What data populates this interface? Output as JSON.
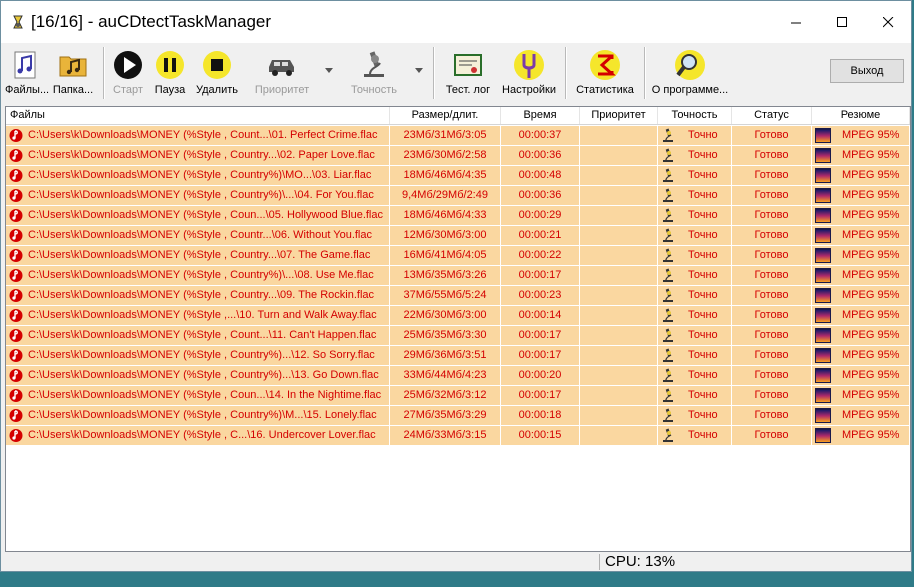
{
  "window": {
    "title": "[16/16] - auCDtectTaskManager"
  },
  "toolbar": {
    "files": "Файлы...",
    "folder": "Папка...",
    "start": "Старт",
    "pause": "Пауза",
    "delete": "Удалить",
    "priority": "Приоритет",
    "accuracy": "Точность",
    "test_log": "Тест. лог",
    "settings": "Настройки",
    "stats": "Статистика",
    "about": "О программе...",
    "exit": "Выход"
  },
  "columns": [
    "Файлы",
    "Размер/длит.",
    "Время",
    "Приоритет",
    "Точность",
    "Статус",
    "Резюме"
  ],
  "rows": [
    {
      "file": "C:\\Users\\k\\Downloads\\MONEY   (%Style , Count...\\01. Perfect Crime.flac",
      "size": "23Мб/31Мб/3:05",
      "time": "00:00:37",
      "priority": "",
      "accuracy": "Точно",
      "status": "Готово",
      "summary": "MPEG 95%"
    },
    {
      "file": "C:\\Users\\k\\Downloads\\MONEY   (%Style , Country...\\02. Paper Love.flac",
      "size": "23Мб/30Мб/2:58",
      "time": "00:00:36",
      "priority": "",
      "accuracy": "Точно",
      "status": "Готово",
      "summary": "MPEG 95%"
    },
    {
      "file": "C:\\Users\\k\\Downloads\\MONEY   (%Style , Country%)\\MO...\\03. Liar.flac",
      "size": "18Мб/46Мб/4:35",
      "time": "00:00:48",
      "priority": "",
      "accuracy": "Точно",
      "status": "Готово",
      "summary": "MPEG 95%"
    },
    {
      "file": "C:\\Users\\k\\Downloads\\MONEY   (%Style , Country%)\\...\\04. For You.flac",
      "size": "9,4Мб/29Мб/2:49",
      "time": "00:00:36",
      "priority": "",
      "accuracy": "Точно",
      "status": "Готово",
      "summary": "MPEG 95%"
    },
    {
      "file": "C:\\Users\\k\\Downloads\\MONEY   (%Style , Coun...\\05. Hollywood Blue.flac",
      "size": "18Мб/46Мб/4:33",
      "time": "00:00:29",
      "priority": "",
      "accuracy": "Точно",
      "status": "Готово",
      "summary": "MPEG 95%"
    },
    {
      "file": "C:\\Users\\k\\Downloads\\MONEY   (%Style , Countr...\\06. Without You.flac",
      "size": "12Мб/30Мб/3:00",
      "time": "00:00:21",
      "priority": "",
      "accuracy": "Точно",
      "status": "Готово",
      "summary": "MPEG 95%"
    },
    {
      "file": "C:\\Users\\k\\Downloads\\MONEY   (%Style , Country...\\07. The Game.flac",
      "size": "16Мб/41Мб/4:05",
      "time": "00:00:22",
      "priority": "",
      "accuracy": "Точно",
      "status": "Готово",
      "summary": "MPEG 95%"
    },
    {
      "file": "C:\\Users\\k\\Downloads\\MONEY   (%Style , Country%)\\...\\08. Use Me.flac",
      "size": "13Мб/35Мб/3:26",
      "time": "00:00:17",
      "priority": "",
      "accuracy": "Точно",
      "status": "Готово",
      "summary": "MPEG 95%"
    },
    {
      "file": "C:\\Users\\k\\Downloads\\MONEY   (%Style , Country...\\09. The Rockin.flac",
      "size": "37Мб/55Мб/5:24",
      "time": "00:00:23",
      "priority": "",
      "accuracy": "Точно",
      "status": "Готово",
      "summary": "MPEG 95%"
    },
    {
      "file": "C:\\Users\\k\\Downloads\\MONEY   (%Style ,...\\10. Turn and Walk Away.flac",
      "size": "22Мб/30Мб/3:00",
      "time": "00:00:14",
      "priority": "",
      "accuracy": "Точно",
      "status": "Готово",
      "summary": "MPEG 95%"
    },
    {
      "file": "C:\\Users\\k\\Downloads\\MONEY   (%Style , Count...\\11. Can't Happen.flac",
      "size": "25Мб/35Мб/3:30",
      "time": "00:00:17",
      "priority": "",
      "accuracy": "Точно",
      "status": "Готово",
      "summary": "MPEG 95%"
    },
    {
      "file": "C:\\Users\\k\\Downloads\\MONEY   (%Style , Country%)...\\12. So Sorry.flac",
      "size": "29Мб/36Мб/3:51",
      "time": "00:00:17",
      "priority": "",
      "accuracy": "Точно",
      "status": "Готово",
      "summary": "MPEG 95%"
    },
    {
      "file": "C:\\Users\\k\\Downloads\\MONEY   (%Style , Country%)...\\13. Go Down.flac",
      "size": "33Мб/44Мб/4:23",
      "time": "00:00:20",
      "priority": "",
      "accuracy": "Точно",
      "status": "Готово",
      "summary": "MPEG 95%"
    },
    {
      "file": "C:\\Users\\k\\Downloads\\MONEY   (%Style , Coun...\\14. In the Nightime.flac",
      "size": "25Мб/32Мб/3:12",
      "time": "00:00:17",
      "priority": "",
      "accuracy": "Точно",
      "status": "Готово",
      "summary": "MPEG 95%"
    },
    {
      "file": "C:\\Users\\k\\Downloads\\MONEY   (%Style , Country%)\\M...\\15. Lonely.flac",
      "size": "27Мб/35Мб/3:29",
      "time": "00:00:18",
      "priority": "",
      "accuracy": "Точно",
      "status": "Готово",
      "summary": "MPEG 95%"
    },
    {
      "file": "C:\\Users\\k\\Downloads\\MONEY   (%Style , C...\\16. Undercover Lover.flac",
      "size": "24Мб/33Мб/3:15",
      "time": "00:00:15",
      "priority": "",
      "accuracy": "Точно",
      "status": "Готово",
      "summary": "MPEG 95%"
    }
  ],
  "statusbar": {
    "cpu": "CPU: 13%"
  },
  "colors": {
    "row_bg": "#fad7a0",
    "row_text": "#d40000"
  }
}
